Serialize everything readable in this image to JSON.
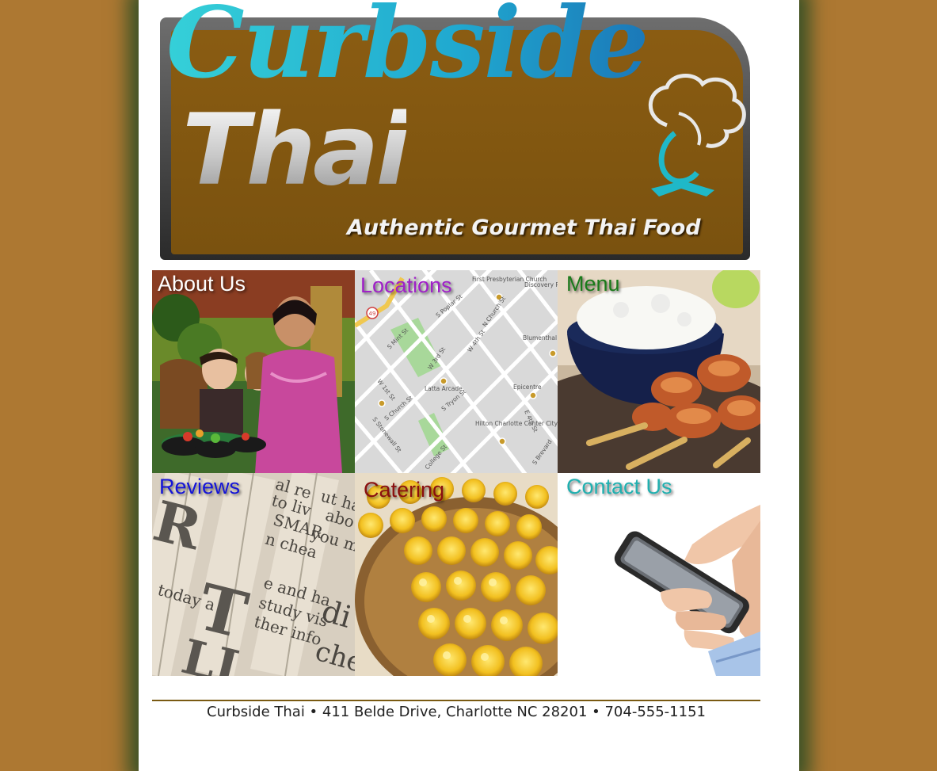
{
  "brand": {
    "script_name": "Curbside",
    "word": "Thai",
    "tagline": "Authentic Gourmet Thai Food"
  },
  "tiles": [
    {
      "label": "About Us",
      "color": "#ffffff"
    },
    {
      "label": "Locations",
      "color": "#a020c8"
    },
    {
      "label": "Menu",
      "color": "#1a7a1a"
    },
    {
      "label": "Reviews",
      "color": "#1414d8"
    },
    {
      "label": "Catering",
      "color": "#8a0f0f"
    },
    {
      "label": "Contact Us",
      "color": "#20b0b0"
    }
  ],
  "map": {
    "labels": [
      "First Presbyterian Church",
      "Discovery Pl",
      "S Poplar St",
      "N Church St",
      "S Mint St",
      "W 3rd St",
      "W 4th St",
      "Blumenthal Performing",
      "W 1st St",
      "Latta Arcade",
      "Epicentre",
      "S Church St",
      "S Tryon St",
      "Hilton Charlotte Center City",
      "S Stonewall St",
      "College St",
      "E 4th St",
      "S Brevard",
      "49"
    ]
  },
  "newspaper": {
    "fragments": [
      "al re",
      "to liv",
      "SMAR",
      "n chea",
      "ut ha",
      "abo",
      "you ma",
      "today a",
      "e and ha",
      "study vis",
      "ther info",
      "di",
      "che"
    ]
  },
  "footer": {
    "text": "Curbside Thai • 411 Belde Drive, Charlotte NC 28201 • 704-555-1151"
  }
}
